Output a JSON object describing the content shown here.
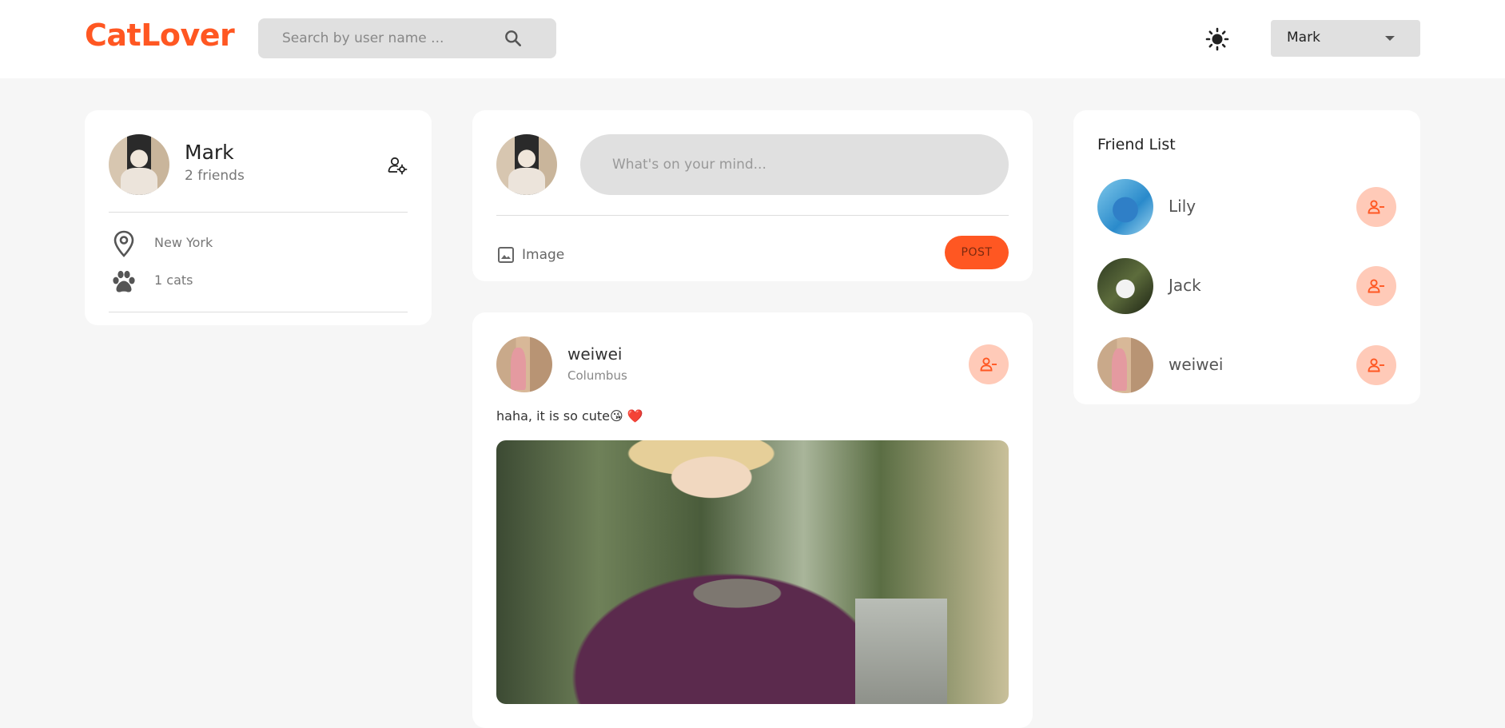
{
  "app": {
    "logo": "CatLover"
  },
  "header": {
    "search_placeholder": "Search by user name ...",
    "user_menu": {
      "selected": "Mark"
    }
  },
  "profile": {
    "name": "Mark",
    "friends": "2 friends",
    "location": "New York",
    "cats": "1 cats"
  },
  "composer": {
    "placeholder": "What's on your mind...",
    "image_label": "Image",
    "post_label": "POST"
  },
  "feed": [
    {
      "author": "weiwei",
      "location": "Columbus",
      "text": "haha, it is so cute😘",
      "text_heart": "❤️"
    }
  ],
  "friend_list": {
    "title": "Friend List",
    "friends": [
      {
        "name": "Lily"
      },
      {
        "name": "Jack"
      },
      {
        "name": "weiwei"
      }
    ]
  },
  "colors": {
    "brand": "#ff5722",
    "unfriend_bg": "#ffcab8",
    "page_bg": "#f6f6f6"
  },
  "icons": [
    "search-icon",
    "sun-icon",
    "chevron-down-icon",
    "manage-accounts-icon",
    "location-pin-icon",
    "paw-icon",
    "image-icon",
    "person-remove-icon"
  ]
}
